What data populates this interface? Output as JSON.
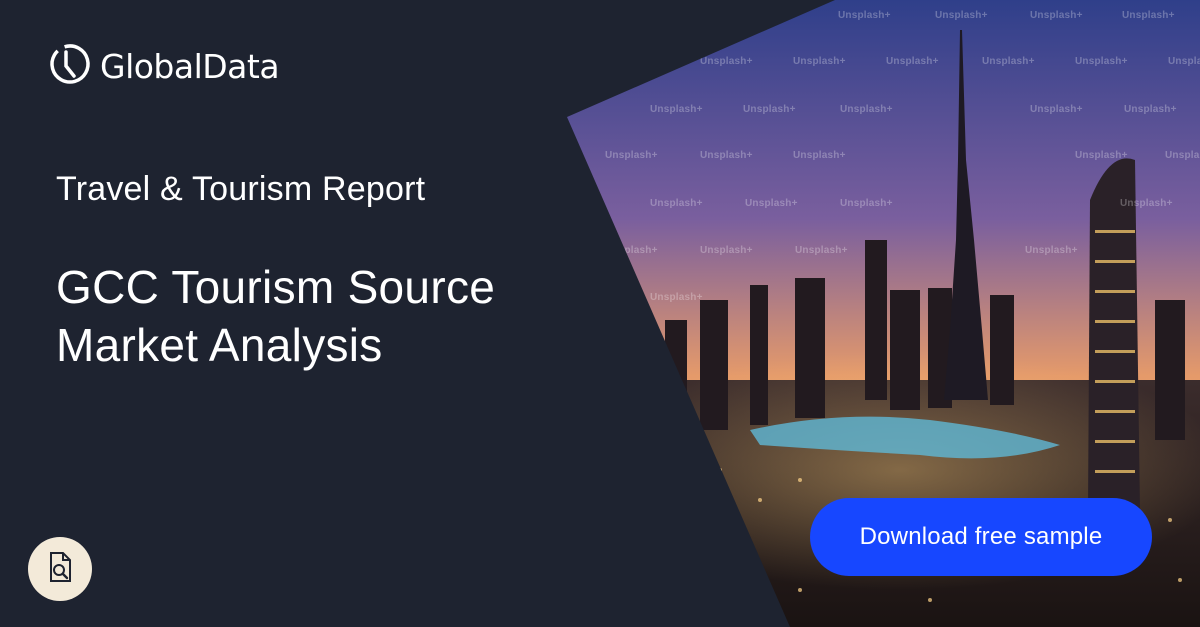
{
  "brand": {
    "name": "GlobalData",
    "logo_icon": "globaldata-logo-icon"
  },
  "report": {
    "category": "Travel & Tourism Report",
    "title": "GCC Tourism Source Market Analysis"
  },
  "cta": {
    "label": "Download free sample"
  },
  "doc_button": {
    "icon": "document-search-icon"
  },
  "photo": {
    "watermark": "Unsplash+"
  },
  "colors": {
    "panel": "#1e2330",
    "cta": "#1747ff",
    "doc_button_bg": "#f3ead9"
  }
}
